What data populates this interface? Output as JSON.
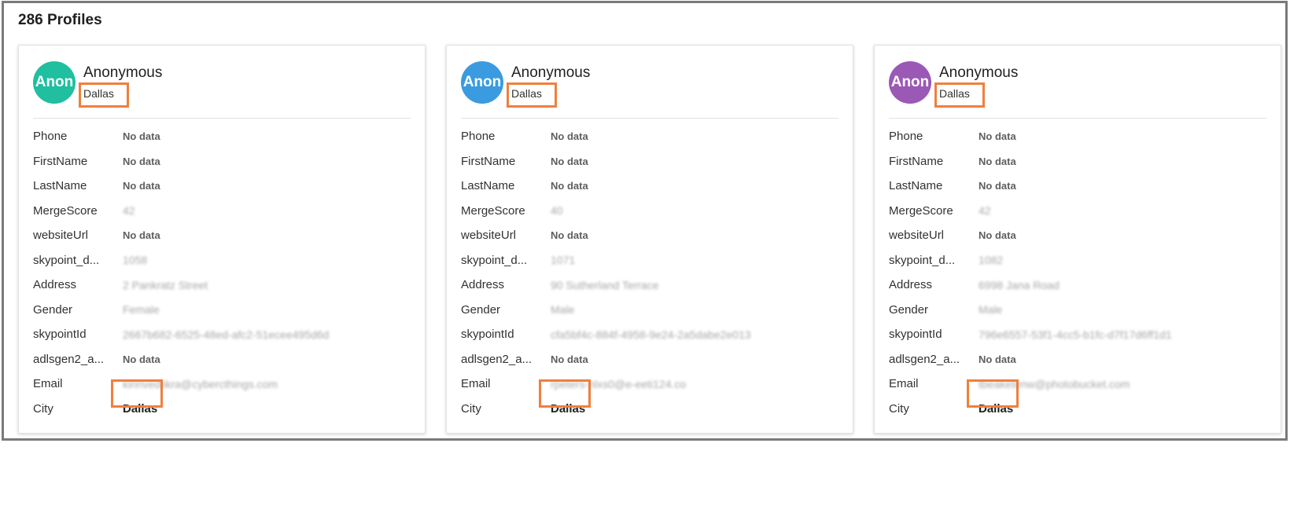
{
  "header": {
    "profile_count": "286 Profiles"
  },
  "colors": {
    "highlight": "#f07f3c",
    "avatar_teal": "#1fbf9f",
    "avatar_blue": "#3a9be0",
    "avatar_purple": "#9b59b6"
  },
  "cards": [
    {
      "avatar_text": "Anon",
      "avatar_color": "#1fbf9f",
      "name": "Anonymous",
      "city_sub": "Dallas",
      "fields": [
        {
          "label": "Phone",
          "value": "No data"
        },
        {
          "label": "FirstName",
          "value": "No data"
        },
        {
          "label": "LastName",
          "value": "No data"
        },
        {
          "label": "MergeScore",
          "value": "42"
        },
        {
          "label": "websiteUrl",
          "value": "No data"
        },
        {
          "label": "skypoint_d...",
          "value": "1058"
        },
        {
          "label": "Address",
          "value": "2 Pankratz Street"
        },
        {
          "label": "Gender",
          "value": "Female"
        },
        {
          "label": "skypointId",
          "value": "2667b682-6525-48ed-afc2-51ecee495d6d"
        },
        {
          "label": "adlsgen2_a...",
          "value": "No data"
        },
        {
          "label": "Email",
          "value": "kiririvedlikra@cybercthings.com"
        },
        {
          "label": "City",
          "value": "Dallas"
        }
      ]
    },
    {
      "avatar_text": "Anon",
      "avatar_color": "#3a9be0",
      "name": "Anonymous",
      "city_sub": "Dallas",
      "fields": [
        {
          "label": "Phone",
          "value": "No data"
        },
        {
          "label": "FirstName",
          "value": "No data"
        },
        {
          "label": "LastName",
          "value": "No data"
        },
        {
          "label": "MergeScore",
          "value": "40"
        },
        {
          "label": "websiteUrl",
          "value": "No data"
        },
        {
          "label": "skypoint_d...",
          "value": "1071"
        },
        {
          "label": "Address",
          "value": "90 Sutherland Terrace"
        },
        {
          "label": "Gender",
          "value": "Male"
        },
        {
          "label": "skypointId",
          "value": "cfa5bf4c-884f-4958-9e24-2a5dabe2e013"
        },
        {
          "label": "adlsgen2_a...",
          "value": "No data"
        },
        {
          "label": "Email",
          "value": "rpeters-nlxs0@e-eeti124.co"
        },
        {
          "label": "City",
          "value": "Dallas"
        }
      ]
    },
    {
      "avatar_text": "Anon",
      "avatar_color": "#9b59b6",
      "name": "Anonymous",
      "city_sub": "Dallas",
      "fields": [
        {
          "label": "Phone",
          "value": "No data"
        },
        {
          "label": "FirstName",
          "value": "No data"
        },
        {
          "label": "LastName",
          "value": "No data"
        },
        {
          "label": "MergeScore",
          "value": "42"
        },
        {
          "label": "websiteUrl",
          "value": "No data"
        },
        {
          "label": "skypoint_d...",
          "value": "1082"
        },
        {
          "label": "Address",
          "value": "6998 Jana Road"
        },
        {
          "label": "Gender",
          "value": "Male"
        },
        {
          "label": "skypointId",
          "value": "796e6557-53f1-4cc5-b1fc-d7f17d6ff1d1"
        },
        {
          "label": "adlsgen2_a...",
          "value": "No data"
        },
        {
          "label": "Email",
          "value": "tbeaketenw@photobucket.com"
        },
        {
          "label": "City",
          "value": "Dallas"
        }
      ]
    }
  ]
}
